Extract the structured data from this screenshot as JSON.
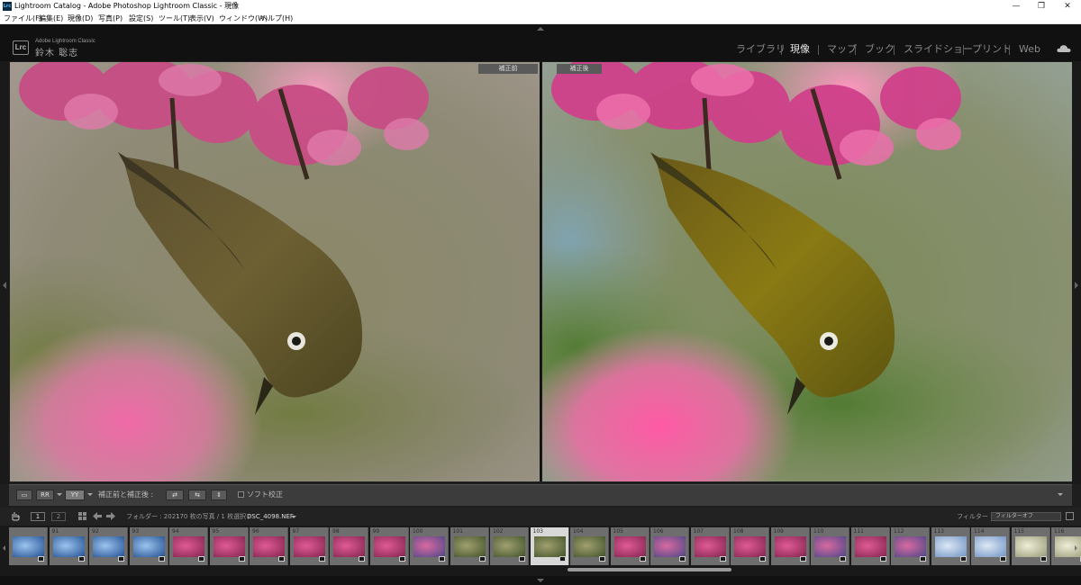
{
  "window": {
    "title": "Lightroom Catalog - Adobe Photoshop Lightroom Classic - 現像",
    "minimize_glyph": "—",
    "restore_glyph": "❐",
    "close_glyph": "✕"
  },
  "menu": [
    "ファイル(F)",
    "編集(E)",
    "現像(D)",
    "写真(P)",
    "設定(S)",
    "ツール(T)",
    "表示(V)",
    "ウィンドウ(W)",
    "ヘルプ(H)"
  ],
  "identity": {
    "badge": "Lrc",
    "app_name": "Adobe Lightroom Classic",
    "user": "鈴木 聡志"
  },
  "modules": [
    "ライブラリ",
    "現像",
    "マップ",
    "ブック",
    "スライドショー",
    "プリント",
    "Web"
  ],
  "active_module": "現像",
  "compare": {
    "before_label": "補正前",
    "after_label": "補正後"
  },
  "toolbar": {
    "view_buttons": [
      "▭",
      "RR",
      "YY"
    ],
    "before_after_label": "補正前と補正後 :",
    "swap_buttons": [
      "⇄",
      "⇆",
      "⇕"
    ],
    "soft_proof_label": "ソフト校正"
  },
  "filmbar": {
    "page1": "1",
    "page2": "2",
    "folder_text": "フォルダー : 2021",
    "count_text": "170 枚の写真 / 1 枚選択 /",
    "filename": "DSC_4098.NEF",
    "filter_label": "フィルター :",
    "filter_value": "フィルターオフ"
  },
  "filmstrip": {
    "selected_number": "103",
    "cells": [
      {
        "num": "",
        "kind": "blue"
      },
      {
        "num": "91",
        "kind": "blue"
      },
      {
        "num": "92",
        "kind": "blue"
      },
      {
        "num": "93",
        "kind": "blue"
      },
      {
        "num": "94",
        "kind": "pink"
      },
      {
        "num": "95",
        "kind": "pink"
      },
      {
        "num": "96",
        "kind": "pink"
      },
      {
        "num": "97",
        "kind": "pink"
      },
      {
        "num": "98",
        "kind": "pink"
      },
      {
        "num": "99",
        "kind": "pink"
      },
      {
        "num": "100",
        "kind": "pinkblue"
      },
      {
        "num": "101",
        "kind": "green"
      },
      {
        "num": "102",
        "kind": "green"
      },
      {
        "num": "103",
        "kind": "green"
      },
      {
        "num": "104",
        "kind": "green"
      },
      {
        "num": "105",
        "kind": "pink"
      },
      {
        "num": "106",
        "kind": "pinkblue"
      },
      {
        "num": "107",
        "kind": "pink"
      },
      {
        "num": "108",
        "kind": "pink"
      },
      {
        "num": "109",
        "kind": "pink"
      },
      {
        "num": "110",
        "kind": "pinkblue"
      },
      {
        "num": "111",
        "kind": "pink"
      },
      {
        "num": "112",
        "kind": "pinkblue"
      },
      {
        "num": "113",
        "kind": "sky"
      },
      {
        "num": "114",
        "kind": "sky"
      },
      {
        "num": "115",
        "kind": "white"
      },
      {
        "num": "116",
        "kind": "white"
      }
    ]
  },
  "colors": {
    "accent": "#d8d8d8",
    "panel": "#1e1e1e",
    "toolbar": "#3c3c3c",
    "blossom": "#d65a92"
  }
}
